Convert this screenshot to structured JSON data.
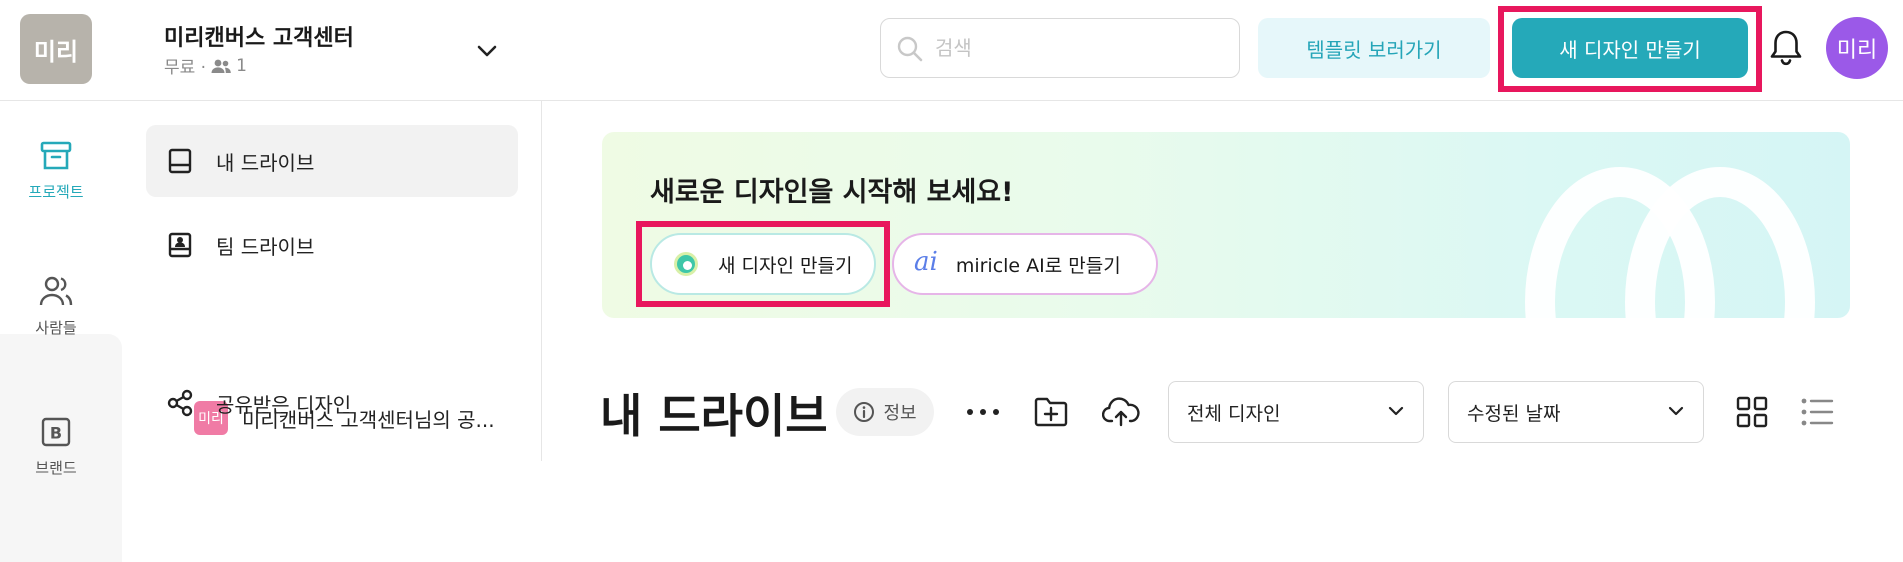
{
  "header": {
    "workspace_avatar": "미리",
    "workspace_name": "미리캔버스 고객센터",
    "workspace_plan": "무료 ·",
    "member_count": "1",
    "search_placeholder": "검색",
    "template_button": "템플릿 보러가기",
    "new_design_button": "새 디자인 만들기",
    "user_avatar": "미리"
  },
  "rail": {
    "items": [
      {
        "label": "프로젝트",
        "icon": "archive-icon",
        "active": true
      },
      {
        "label": "사람들",
        "icon": "people-icon"
      },
      {
        "label": "브랜드",
        "icon": "brand-icon"
      }
    ]
  },
  "sidebar": {
    "my_drive": "내 드라이브",
    "team_drive": "팀 드라이브",
    "team_badge": "미리",
    "team_shared": "미리캔버스 고객센터님의 공...",
    "shared_designs": "공유받은 디자인"
  },
  "banner": {
    "title": "새로운 디자인을 시작해 보세요!",
    "new_design": "새 디자인 만들기",
    "ai_button": "miricle AI로 만들기",
    "ai_logo": "ai"
  },
  "drive": {
    "title": "내 드라이브",
    "info": "정보",
    "filter_type": "전체 디자인",
    "sort": "수정된 날짜"
  },
  "colors": {
    "accent": "#25a9b9",
    "highlight": "#e8175d",
    "avatar_purple": "#9b59e8"
  }
}
